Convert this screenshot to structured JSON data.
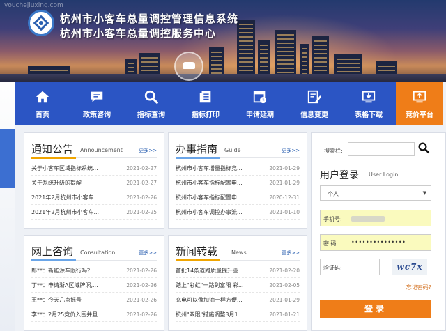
{
  "header": {
    "watermark": "youchejiuxing.com",
    "title_line1": "杭州市小客车总量调控管理信息系统",
    "title_line2": "杭州市小客车总量调控服务中心"
  },
  "nav": {
    "items": [
      {
        "label": "首页",
        "icon": "home-icon"
      },
      {
        "label": "政策咨询",
        "icon": "chat-icon"
      },
      {
        "label": "指标查询",
        "icon": "search-icon"
      },
      {
        "label": "指标打印",
        "icon": "document-icon"
      },
      {
        "label": "申请延期",
        "icon": "calendar-icon"
      },
      {
        "label": "信息变更",
        "icon": "edit-icon"
      },
      {
        "label": "表格下载",
        "icon": "download-icon"
      },
      {
        "label": "竞价平台",
        "icon": "monitor-icon"
      }
    ],
    "active_color": "#ef7d18",
    "bar_color": "#2b55c4"
  },
  "panels": {
    "notice": {
      "title": "通知公告",
      "subtitle": "Announcement",
      "more": "更多>>",
      "rows": [
        {
          "title": "关于小客车区域指标系统...",
          "date": "2021-02-27"
        },
        {
          "title": "关于系统升级的提醒",
          "date": "2021-02-27"
        },
        {
          "title": "2021年2月杭州市小客车...",
          "date": "2021-02-26"
        },
        {
          "title": "2021年2月杭州市小客车...",
          "date": "2021-02-25"
        }
      ]
    },
    "guide": {
      "title": "办事指南",
      "subtitle": "Guide",
      "more": "更多>>",
      "rows": [
        {
          "title": "杭州市小客车增量指标竞...",
          "date": "2021-01-29"
        },
        {
          "title": "杭州市小客车指标配置申...",
          "date": "2021-01-29"
        },
        {
          "title": "杭州市小客车指标配置申...",
          "date": "2020-12-31"
        },
        {
          "title": "杭州市小客车调控办事流...",
          "date": "2021-01-10"
        }
      ]
    },
    "consult": {
      "title": "网上咨询",
      "subtitle": "Consultation",
      "more": "更多>>",
      "rows": [
        {
          "title": "郎**：新能源车限行吗？",
          "date": "2021-02-26"
        },
        {
          "title": "丁**：申请浙A区域牌照,...",
          "date": "2021-02-26"
        },
        {
          "title": "王**：今天几点摇号",
          "date": "2021-02-26"
        },
        {
          "title": "李**：2月25竞价入围并且...",
          "date": "2021-02-26"
        }
      ]
    },
    "news": {
      "title": "新闻转载",
      "subtitle": "News",
      "more": "更多>>",
      "rows": [
        {
          "title": "首批14条道路质量提升亚...",
          "date": "2021-02-20"
        },
        {
          "title": "踏上\"彩虹\"一路到富阳 彩...",
          "date": "2021-02-05"
        },
        {
          "title": "充电可以像加油一样方便...",
          "date": "2021-01-29"
        },
        {
          "title": "杭州\"双限\"措施调整3月1...",
          "date": "2021-01-21"
        }
      ]
    }
  },
  "login": {
    "search_label": "搜索栏:",
    "title": "用户登录",
    "subtitle": "User Login",
    "user_type": "个人",
    "phone_label": "手机号:",
    "password_label": "密  码:",
    "password_value": "•••••••••••••••",
    "captcha_label": "验证码:",
    "captcha_text": "wc7x",
    "forgot": "忘记密码?",
    "login_button": "登录"
  }
}
